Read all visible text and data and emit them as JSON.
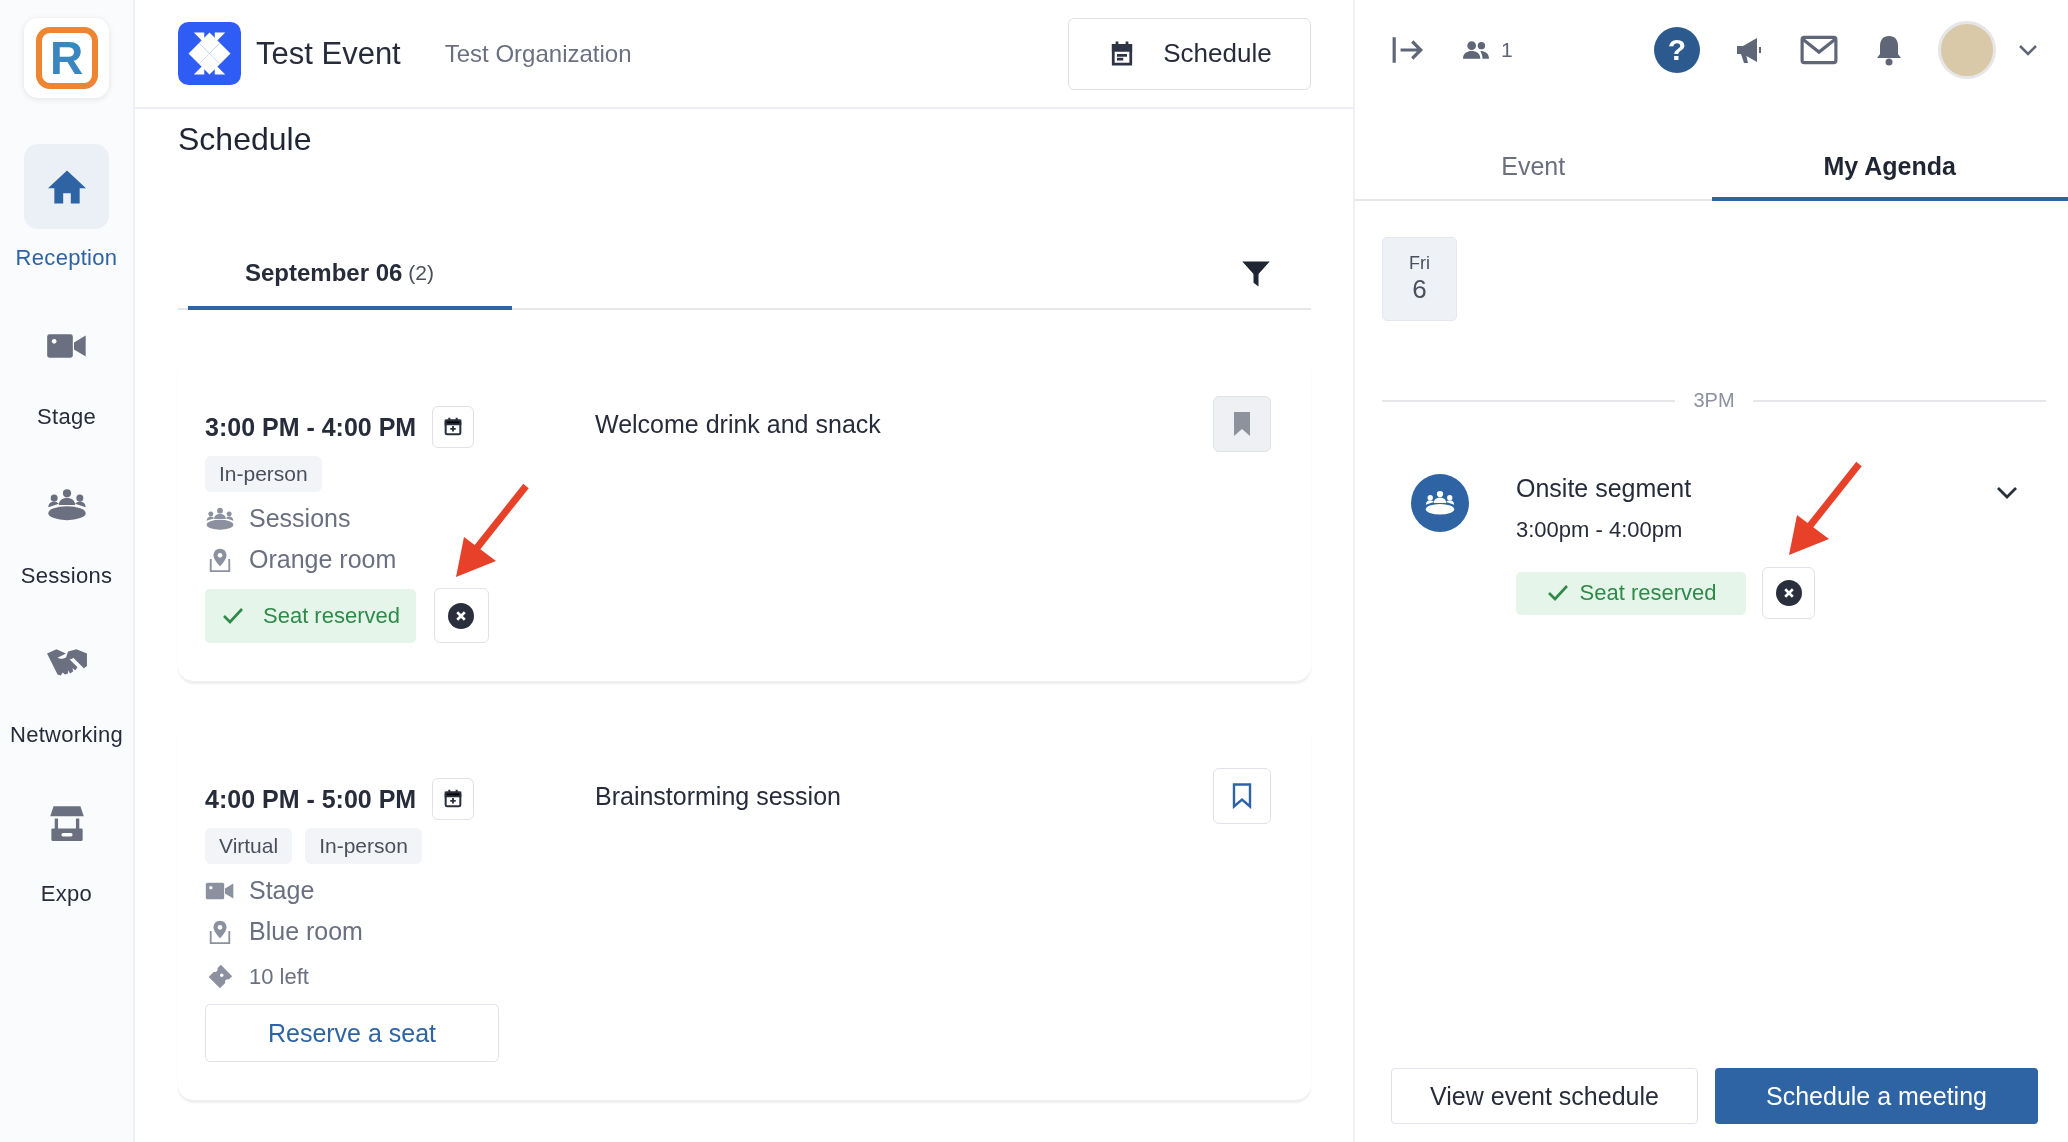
{
  "app_logo": {
    "letter": "R"
  },
  "sidebar": {
    "items": [
      {
        "label": "Reception",
        "kind": "home",
        "selected": true
      },
      {
        "label": "Stage",
        "kind": "video",
        "selected": false
      },
      {
        "label": "Sessions",
        "kind": "sessions",
        "selected": false
      },
      {
        "label": "Networking",
        "kind": "handshake",
        "selected": false
      },
      {
        "label": "Expo",
        "kind": "booth",
        "selected": false
      }
    ]
  },
  "header": {
    "event_title": "Test Event",
    "organization": "Test Organization",
    "schedule_button": "Schedule"
  },
  "page": {
    "title": "Schedule",
    "date_tabs": [
      {
        "label": "September 06",
        "count": "(2)",
        "selected": true
      }
    ],
    "sessions": [
      {
        "time": "3:00 PM - 4:00 PM",
        "title": "Welcome drink and snack",
        "tags": [
          "In-person"
        ],
        "details": [
          {
            "kind": "sessions",
            "text": "Sessions"
          },
          {
            "kind": "location",
            "text": "Orange room"
          }
        ],
        "bookmark_disabled": true,
        "reservation": {
          "kind": "reserved",
          "label": "Seat reserved",
          "annotated": true
        }
      },
      {
        "time": "4:00 PM - 5:00 PM",
        "title": "Brainstorming session",
        "tags": [
          "Virtual",
          "In-person"
        ],
        "details": [
          {
            "kind": "video",
            "text": "Stage"
          },
          {
            "kind": "location",
            "text": "Blue room"
          },
          {
            "kind": "ticket",
            "text": "10 left"
          }
        ],
        "bookmark_disabled": false,
        "reservation": {
          "kind": "button",
          "label": "Reserve a seat",
          "annotated": false
        }
      }
    ]
  },
  "right_panel": {
    "attendee_count": "1",
    "help_label": "?",
    "tabs": [
      {
        "label": "Event",
        "selected": false
      },
      {
        "label": "My Agenda",
        "selected": true
      }
    ],
    "days": [
      {
        "weekday": "Fri",
        "day": "6",
        "selected": true
      }
    ],
    "time_divider": "3PM",
    "agenda": [
      {
        "title": "Onsite segment",
        "time": "3:00pm - 4:00pm",
        "status": "Seat reserved",
        "expanded": false,
        "annotated": true
      }
    ],
    "buttons": [
      {
        "label": "View event schedule",
        "kind": "secondary"
      },
      {
        "label": "Schedule a meeting",
        "kind": "primary"
      }
    ]
  }
}
